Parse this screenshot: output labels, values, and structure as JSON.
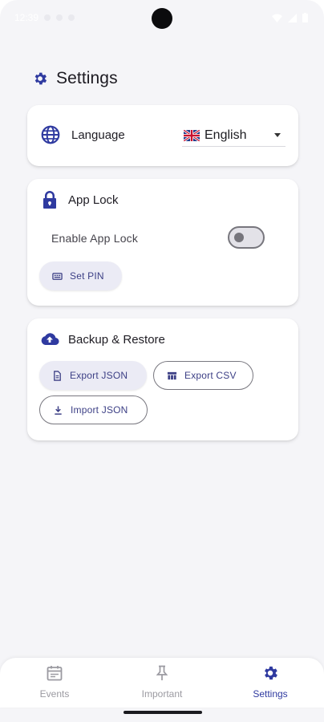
{
  "status_bar": {
    "time": "12:39"
  },
  "header": {
    "title": "Settings",
    "icon": "gear-icon"
  },
  "language": {
    "label": "Language",
    "icon": "globe-icon",
    "selected_value": "English",
    "flag": "uk-flag-icon"
  },
  "app_lock": {
    "title": "App Lock",
    "icon": "lock-icon",
    "toggle_label": "Enable App Lock",
    "toggle_state": "off",
    "set_pin_label": "Set PIN"
  },
  "backup": {
    "title": "Backup & Restore",
    "icon": "cloud-upload-icon",
    "export_json_label": "Export JSON",
    "export_csv_label": "Export CSV",
    "import_json_label": "Import JSON"
  },
  "bottom_nav": {
    "items": [
      {
        "label": "Events",
        "icon": "calendar-icon",
        "active": false
      },
      {
        "label": "Important",
        "icon": "pin-icon",
        "active": false
      },
      {
        "label": "Settings",
        "icon": "gear-icon",
        "active": true
      }
    ]
  },
  "colors": {
    "accent": "#2f3aa0",
    "background": "#f5f5f8",
    "card": "#ffffff",
    "inactive": "#9b9aa1"
  }
}
